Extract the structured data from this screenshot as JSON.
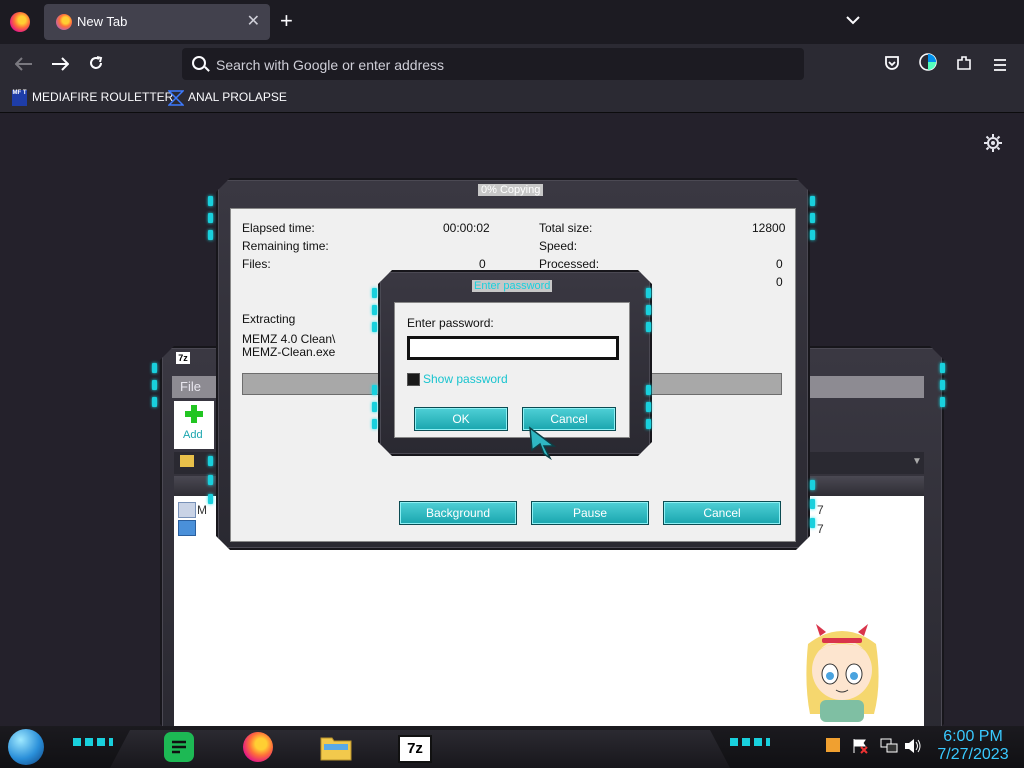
{
  "browser": {
    "tab_title": "New Tab",
    "new_tab": "+",
    "tab_close": "✕",
    "tab_list": "⌄",
    "url_placeholder": "Search with Google or enter address",
    "bookmarks": [
      {
        "label": "MEDIAFIRE ROULETTER",
        "icon": "mediafire-icon",
        "icon_text": "MF T"
      },
      {
        "label": "ANAL PROLAPSE",
        "icon": "bookmark-shape-icon"
      }
    ]
  },
  "sevenzip_main": {
    "menu_file": "File",
    "add_label": "Add",
    "app_icon_text": "7z",
    "list_item_prefix": "M",
    "col_values": [
      "7",
      "7"
    ]
  },
  "copy_dialog": {
    "title": "0% Copying",
    "elapsed_label": "Elapsed time:",
    "elapsed_value": "00:00:02",
    "remaining_label": "Remaining time:",
    "files_label": "Files:",
    "files_value": "0",
    "total_label": "Total size:",
    "total_value": "12800",
    "speed_label": "Speed:",
    "processed_label": "Processed:",
    "processed_value": "0",
    "extra_value": "0",
    "extracting_label": "Extracting",
    "extracting_path_1": "MEMZ 4.0 Clean\\",
    "extracting_path_2": "MEMZ-Clean.exe",
    "background_btn": "Background",
    "pause_btn": "Pause",
    "cancel_btn": "Cancel"
  },
  "password_dialog": {
    "title": "Enter password",
    "prompt": "Enter password:",
    "value": "",
    "show_password": "Show password",
    "ok_btn": "OK",
    "cancel_btn": "Cancel"
  },
  "taskbar": {
    "app_7z": "7z",
    "time": "6:00 PM",
    "date": "7/27/2023"
  },
  "colors": {
    "accent": "#19d0dd",
    "clock": "#39c9ff"
  }
}
